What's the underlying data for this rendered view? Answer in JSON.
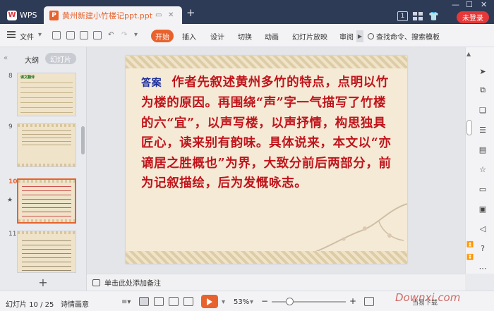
{
  "titlebar": {
    "app_tab": "WPS",
    "document_tab": "黄州新建小竹楼记ppt.ppt",
    "login_button": "未登录",
    "tab_count": "1"
  },
  "menubar": {
    "file": "文件",
    "start": "开始",
    "tabs": [
      "插入",
      "设计",
      "切换",
      "动画",
      "幻灯片放映",
      "审阅"
    ],
    "search": "查找命令、搜索模板"
  },
  "left_panel": {
    "tab_outline": "大纲",
    "tab_slides": "幻灯片",
    "thumbnails": [
      {
        "number": "8",
        "text": "课文翻译"
      },
      {
        "number": "9",
        "text": ""
      },
      {
        "number": "10",
        "text": ""
      },
      {
        "number": "11",
        "text": ""
      }
    ]
  },
  "slide": {
    "answer_label": "答案",
    "body": "作者先叙述黄州多竹的特点，点明以竹为楼的原因。再围绕“声”字一气描写了竹楼的六“宜”，以声写楼，以声抒情，构思独具匠心，读来别有韵味。具体说来，本文以“亦谪居之胜概也”为界，大致分前后两部分，前为记叙描绘，后为发慨咏志。"
  },
  "notes": {
    "placeholder": "单击此处添加备注"
  },
  "statusbar": {
    "slide_counter": "幻灯片 10 / 25",
    "theme": "诗情画意",
    "zoom": "53%"
  },
  "watermark": {
    "logo_text": "Downxi.com",
    "sub_text": "当易下载"
  },
  "colors": {
    "accent": "#e8622d",
    "titlebar_bg": "#2d3b57",
    "slide_text": "#c0141b",
    "answer_label": "#1b2d9c"
  }
}
